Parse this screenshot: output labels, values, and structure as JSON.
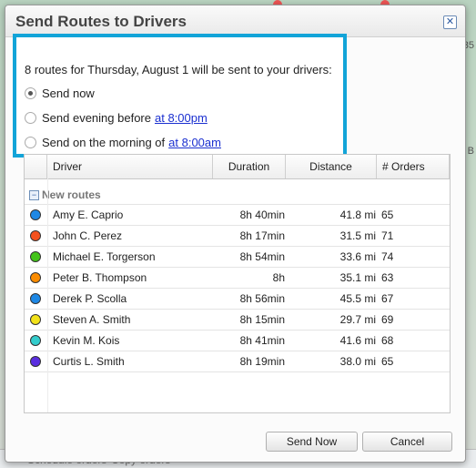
{
  "background": {
    "right_labels": [
      "35",
      "B"
    ],
    "bottom_bar": [
      "Schedule orders",
      "Copy orders"
    ]
  },
  "dialog": {
    "title": "Send Routes to Drivers",
    "close_glyph": "✕",
    "message": "8 routes for Thursday, August 1 will be sent to your drivers:",
    "options": [
      {
        "label": "Send now",
        "link": "",
        "selected": true
      },
      {
        "label": "Send evening before",
        "link": "at 8:00pm",
        "selected": false
      },
      {
        "label": "Send on the morning of",
        "link": "at 8:00am",
        "selected": false
      }
    ],
    "table": {
      "columns": [
        "Driver",
        "Duration",
        "Distance",
        "# Orders"
      ],
      "group_label": "New routes",
      "group_icon": "−",
      "rows": [
        {
          "name": "Amy E. Caprio",
          "duration": "8h 40min",
          "distance": "41.8 mi",
          "orders": "65",
          "color": "#1e88e5"
        },
        {
          "name": "John C. Perez",
          "duration": "8h 17min",
          "distance": "31.5 mi",
          "orders": "71",
          "color": "#f4511e"
        },
        {
          "name": "Michael E. Torgerson",
          "duration": "8h 54min",
          "distance": "33.6 mi",
          "orders": "74",
          "color": "#43c41a"
        },
        {
          "name": "Peter B. Thompson",
          "duration": "8h",
          "distance": "35.1 mi",
          "orders": "63",
          "color": "#fb8c00"
        },
        {
          "name": "Derek P. Scolla",
          "duration": "8h 56min",
          "distance": "45.5 mi",
          "orders": "67",
          "color": "#1e88e5"
        },
        {
          "name": "Steven A. Smith",
          "duration": "8h 15min",
          "distance": "29.7 mi",
          "orders": "69",
          "color": "#f2e21a"
        },
        {
          "name": "Kevin M. Kois",
          "duration": "8h 41min",
          "distance": "41.6 mi",
          "orders": "68",
          "color": "#33cccc"
        },
        {
          "name": "Curtis L. Smith",
          "duration": "8h 19min",
          "distance": "38.0 mi",
          "orders": "65",
          "color": "#5a2ee0"
        }
      ]
    },
    "buttons": {
      "send_now": "Send Now",
      "cancel": "Cancel"
    }
  }
}
